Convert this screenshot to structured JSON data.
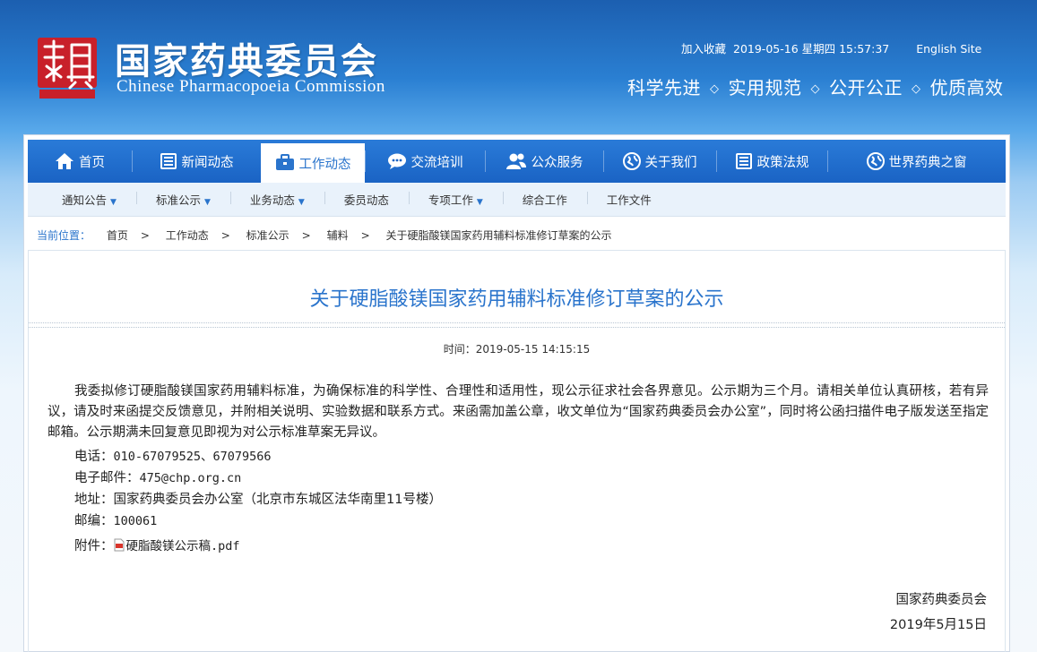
{
  "header": {
    "cn_title": "国家药典委员会",
    "en_title": "Chinese Pharmacopoeia Commission",
    "bookmark": "加入收藏",
    "datetime": "2019-05-16 星期四 15:57:37",
    "english_site": "English Site",
    "slogans": [
      "科学先进",
      "实用规范",
      "公开公正",
      "优质高效"
    ],
    "slogan_sep": "◇"
  },
  "nav": {
    "items": [
      {
        "label": "首页",
        "icon": "home-icon"
      },
      {
        "label": "新闻动态",
        "icon": "list-icon"
      },
      {
        "label": "工作动态",
        "icon": "briefcase-icon"
      },
      {
        "label": "交流培训",
        "icon": "chat-icon"
      },
      {
        "label": "公众服务",
        "icon": "users-icon"
      },
      {
        "label": "关于我们",
        "icon": "globe-icon"
      },
      {
        "label": "政策法规",
        "icon": "list-icon"
      },
      {
        "label": "世界药典之窗",
        "icon": "globe-icon"
      }
    ],
    "active_index": 2
  },
  "subnav": {
    "items": [
      "通知公告",
      "标准公示",
      "业务动态",
      "委员动态",
      "专项工作",
      "综合工作",
      "工作文件"
    ]
  },
  "breadcrumb": {
    "label": "当前位置：",
    "items": [
      "首页",
      "工作动态",
      "标准公示",
      "辅料",
      "关于硬脂酸镁国家药用辅料标准修订草案的公示"
    ],
    "sep": ">"
  },
  "article": {
    "title": "关于硬脂酸镁国家药用辅料标准修订草案的公示",
    "time_label": "时间：",
    "time": "2019-05-15 14:15:15",
    "body": "我委拟修订硬脂酸镁国家药用辅料标准，为确保标准的科学性、合理性和适用性，现公示征求社会各界意见。公示期为三个月。请相关单位认真研核，若有异议，请及时来函提交反馈意见，并附相关说明、实验数据和联系方式。来函需加盖公章，收文单位为“国家药典委员会办公室”，同时将公函扫描件电子版发送至指定邮箱。公示期满未回复意见即视为对公示标准草案无异议。",
    "phone_label": "电话：",
    "phone": "010-67079525、67079566",
    "email_label": "电子邮件：",
    "email": "475@chp.org.cn",
    "address_label": "地址：",
    "address": "国家药典委员会办公室（北京市东城区法华南里11号楼）",
    "postcode_label": "邮编：",
    "postcode": "100061",
    "attachment_label": "附件：",
    "attachment": "硬脂酸镁公示稿.pdf",
    "signature": "国家药典委员会",
    "sign_date": "2019年5月15日"
  },
  "colors": {
    "nav_blue": "#1a63c4",
    "link_blue": "#2a74cc",
    "seal_red": "#c8202a"
  }
}
